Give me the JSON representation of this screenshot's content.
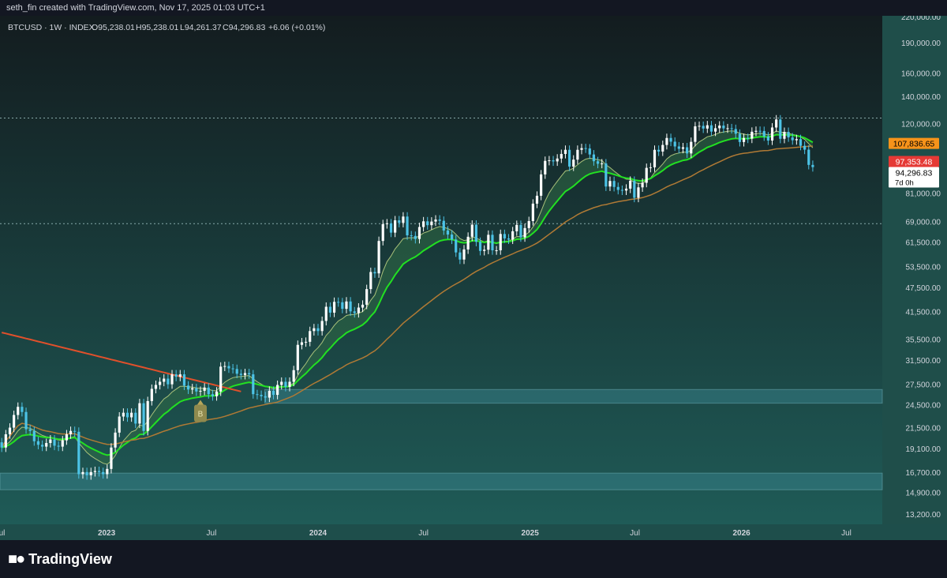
{
  "header": {
    "attribution": "seth_fin created with TradingView.com, Nov 17, 2025 01:03 UTC+1"
  },
  "footer": {
    "logo_text": "TradingView"
  },
  "colors": {
    "up": "#ffffff",
    "down": "#4cc3e6",
    "ema_fast": "#a8c07a",
    "ema_mid": "#22e022",
    "ema_slow": "#c0c0c0",
    "sma_long": "#e0502b",
    "ma_brown": "#b07a35",
    "ribbon_fill": "#2f6b45",
    "ribbon_fill_bear": "#7a6a62",
    "zone_fill": "#3b8a95",
    "price_orange": "#f7931a",
    "price_red": "#e53935",
    "price_white": "#ffffff",
    "bg_top": "#131c1f",
    "bg_bottom": "#1f5b57"
  },
  "chart_data": {
    "type": "candlestick",
    "symbol_line": {
      "symbol": "BTCUSD · 1W · INDEX",
      "o_label": "O",
      "o_value": "95,238.01",
      "h_label": "H",
      "h_value": "95,238.01",
      "l_label": "L",
      "l_value": "94,261.37",
      "c_label": "C",
      "c_value": "94,296.83",
      "change": "+6.06 (+0.01%)"
    },
    "y_scale": "log",
    "y_range": [
      12500,
      222000
    ],
    "y_ticks": [
      {
        "value": 220000,
        "label": "220,000.00"
      },
      {
        "value": 190000,
        "label": "190,000.00"
      },
      {
        "value": 160000,
        "label": "160,000.00"
      },
      {
        "value": 140000,
        "label": "140,000.00"
      },
      {
        "value": 120000,
        "label": "120,000.00"
      },
      {
        "value": 81000,
        "label": "81,000.00"
      },
      {
        "value": 69000,
        "label": "69,000.00"
      },
      {
        "value": 61500,
        "label": "61,500.00"
      },
      {
        "value": 53500,
        "label": "53,500.00"
      },
      {
        "value": 47500,
        "label": "47,500.00"
      },
      {
        "value": 41500,
        "label": "41,500.00"
      },
      {
        "value": 35500,
        "label": "35,500.00"
      },
      {
        "value": 31500,
        "label": "31,500.00"
      },
      {
        "value": 27500,
        "label": "27,500.00"
      },
      {
        "value": 24500,
        "label": "24,500.00"
      },
      {
        "value": 21500,
        "label": "21,500.00"
      },
      {
        "value": 19100,
        "label": "19,100.00"
      },
      {
        "value": 16700,
        "label": "16,700.00"
      },
      {
        "value": 14900,
        "label": "14,900.00"
      },
      {
        "value": 13200,
        "label": "13,200.00"
      }
    ],
    "x_range": [
      "2022-07-01",
      "2026-09-01"
    ],
    "x_ticks": [
      {
        "date": "2022-07-01",
        "label": "Jul",
        "bold": false
      },
      {
        "date": "2023-01-01",
        "label": "2023",
        "bold": true
      },
      {
        "date": "2023-07-01",
        "label": "Jul",
        "bold": false
      },
      {
        "date": "2024-01-01",
        "label": "2024",
        "bold": true
      },
      {
        "date": "2024-07-01",
        "label": "Jul",
        "bold": false
      },
      {
        "date": "2025-01-01",
        "label": "2025",
        "bold": true
      },
      {
        "date": "2025-07-01",
        "label": "Jul",
        "bold": false
      },
      {
        "date": "2026-01-01",
        "label": "2026",
        "bold": true
      },
      {
        "date": "2026-07-01",
        "label": "Jul",
        "bold": false
      }
    ],
    "price_labels": [
      {
        "value": 107836.65,
        "label": "107,836.65",
        "color": "#f7931a",
        "text_color": "#000000"
      },
      {
        "value": 97353.48,
        "label": "97,353.48",
        "color": "#e53935",
        "text_color": "#ffffff"
      },
      {
        "value": 94296.83,
        "label": "94,296.83",
        "sub": "7d 0h",
        "color": "#ffffff",
        "text_color": "#000000"
      }
    ],
    "horizontal_lines": [
      {
        "value": 124500
      },
      {
        "value": 68500
      }
    ],
    "zones": [
      {
        "x_from": "2023-10-01",
        "x_to": "2026-09-01",
        "y_from": 24800,
        "y_to": 26800
      },
      {
        "x_from": "2022-07-01",
        "x_to": "2026-09-01",
        "y_from": 15200,
        "y_to": 16700
      }
    ],
    "marker": {
      "date": "2023-06-12",
      "label": "B"
    },
    "start": "2022-07-04",
    "close_values": [
      19300,
      20800,
      21600,
      23200,
      24300,
      23600,
      21400,
      21200,
      20000,
      19600,
      19400,
      19800,
      20200,
      19500,
      19400,
      20100,
      20800,
      21200,
      21100,
      16600,
      16800,
      16500,
      16800,
      16900,
      16800,
      16600,
      17100,
      19300,
      21000,
      23000,
      23500,
      22900,
      23500,
      22100,
      24800,
      21200,
      25100,
      26900,
      27500,
      28000,
      28500,
      27600,
      29200,
      28800,
      29200,
      27400,
      26800,
      27000,
      26500,
      26600,
      27100,
      26100,
      25800,
      26500,
      30500,
      30600,
      30200,
      30100,
      29300,
      29100,
      29400,
      29200,
      26100,
      26000,
      25800,
      25600,
      26600,
      26000,
      27500,
      28000,
      27200,
      28000,
      29900,
      34500,
      35000,
      35100,
      37300,
      37900,
      37300,
      39500,
      42800,
      41400,
      44000,
      43900,
      42300,
      44100,
      41700,
      41300,
      42600,
      43300,
      47300,
      52100,
      51700,
      62100,
      68300,
      68600,
      65100,
      69800,
      68800,
      71300,
      64100,
      63900,
      62800,
      67200,
      69400,
      67900,
      69300,
      70100,
      69600,
      65900,
      64400,
      62600,
      58200,
      55900,
      59200,
      63600,
      68100,
      61800,
      58700,
      59100,
      64300,
      58900,
      58900,
      64600,
      63000,
      62600,
      65600,
      68000,
      63400,
      66800,
      69500,
      76700,
      80200,
      90500,
      97700,
      98000,
      97400,
      99000,
      101600,
      104000,
      94600,
      98400,
      104000,
      105000,
      104800,
      101300,
      97500,
      96100,
      96300,
      84500,
      87200,
      84300,
      82900,
      82600,
      83500,
      87300,
      79300,
      84100,
      86300,
      93900,
      94200,
      104000,
      103000,
      106900,
      111200,
      108900,
      106000,
      104600,
      105500,
      101900,
      108800,
      118800,
      119100,
      117300,
      119500,
      115300,
      117500,
      119300,
      117400,
      117500,
      117000,
      113900,
      108700,
      111200,
      110800,
      115200,
      115800,
      115700,
      112200,
      109600,
      118000,
      123500,
      110700,
      115100,
      111600,
      109800,
      110500,
      106400,
      104100,
      95500,
      94300
    ],
    "ohlc": [
      {
        "t": "2025-11-10",
        "o": 95238.01,
        "h": 95238.01,
        "l": 94261.37,
        "c": 94296.83
      }
    ],
    "indicators": [
      {
        "name": "MA 50W",
        "color": "#b07a35"
      },
      {
        "name": "EMA ribbon",
        "color": "#22e022"
      },
      {
        "name": "SMA long",
        "color": "#e0502b"
      }
    ]
  }
}
